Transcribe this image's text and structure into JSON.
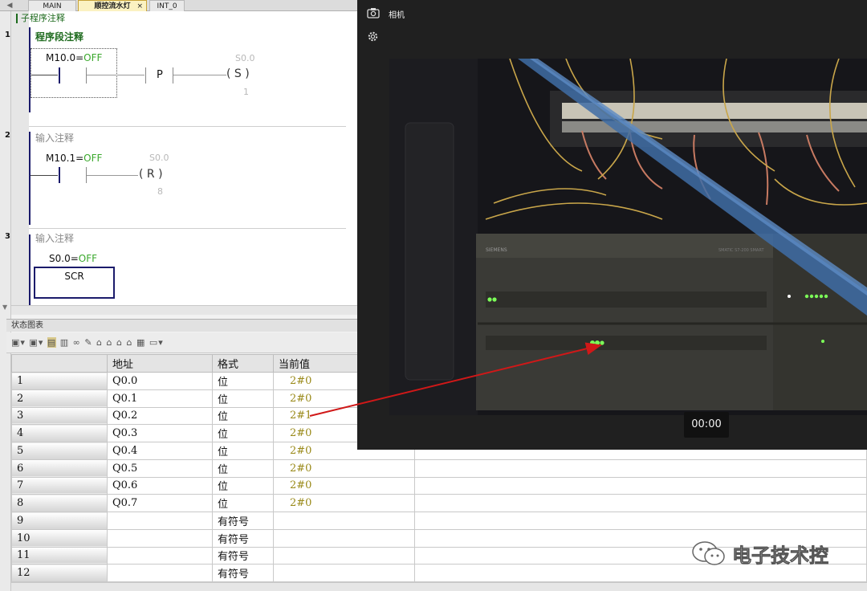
{
  "tabs": {
    "arrow": "◀",
    "main": "MAIN",
    "seq": "顺控流水灯",
    "seq_close": "×",
    "int0": "INT_0"
  },
  "editor": {
    "sub_comment": "子程序注释",
    "networks": [
      {
        "num": "1",
        "title": "程序段注释",
        "contact_addr": "M10.0",
        "contact_state": "OFF",
        "coil_addr": "S0.0",
        "edge": "P",
        "coil": "S",
        "coil_n": "1"
      },
      {
        "num": "2",
        "title": "输入注释",
        "contact_addr": "M10.1",
        "contact_state": "OFF",
        "coil_addr": "S0.0",
        "coil": "R",
        "coil_n": "8"
      },
      {
        "num": "3",
        "title": "输入注释",
        "contact_addr": "S0.0",
        "contact_state": "OFF",
        "box": "SCR"
      }
    ],
    "eq": "="
  },
  "status_chart": {
    "title": "状态图表",
    "columns": [
      "",
      "地址",
      "格式",
      "当前值"
    ],
    "rows": [
      {
        "n": "1",
        "addr": "Q0.0",
        "fmt": "位",
        "val": "2#0"
      },
      {
        "n": "2",
        "addr": "Q0.1",
        "fmt": "位",
        "val": "2#0"
      },
      {
        "n": "3",
        "addr": "Q0.2",
        "fmt": "位",
        "val": "2#1"
      },
      {
        "n": "4",
        "addr": "Q0.3",
        "fmt": "位",
        "val": "2#0"
      },
      {
        "n": "5",
        "addr": "Q0.4",
        "fmt": "位",
        "val": "2#0"
      },
      {
        "n": "6",
        "addr": "Q0.5",
        "fmt": "位",
        "val": "2#0"
      },
      {
        "n": "7",
        "addr": "Q0.6",
        "fmt": "位",
        "val": "2#0"
      },
      {
        "n": "8",
        "addr": "Q0.7",
        "fmt": "位",
        "val": "2#0"
      },
      {
        "n": "9",
        "addr": "",
        "fmt": "有符号",
        "val": ""
      },
      {
        "n": "10",
        "addr": "",
        "fmt": "有符号",
        "val": ""
      },
      {
        "n": "11",
        "addr": "",
        "fmt": "有符号",
        "val": ""
      },
      {
        "n": "12",
        "addr": "",
        "fmt": "有符号",
        "val": ""
      }
    ]
  },
  "camera": {
    "title": "相机",
    "time": "00:00",
    "plc_brand": "SIEMENS",
    "plc_model": "SMATIC S7-200 SMART"
  },
  "watermark": {
    "text": "电子技术控"
  },
  "colors": {
    "off_green": "#3aa82c",
    "rail_blue": "#1b1b6b",
    "comment_green": "#1d6a1d",
    "arrow_red": "#d01818",
    "value_olive": "#9a8a1a"
  },
  "icons": [
    "camera-icon",
    "gear-icon",
    "wechat-icon"
  ]
}
